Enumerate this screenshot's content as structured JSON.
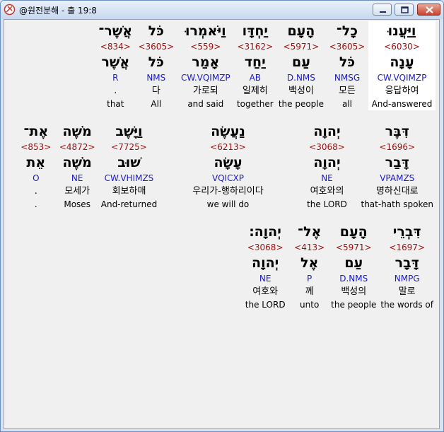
{
  "window": {
    "title": "@원전분해 - 출 19:8"
  },
  "rows": [
    [
      {
        "heb": "וַיַּעֲנוּ",
        "strong": "<6030>",
        "lex": "עָנָה",
        "morph": "CW.VQIMZP",
        "kor": "응답하여",
        "eng": "And-answered",
        "sel": true
      },
      {
        "heb": "כָל־",
        "strong": "<3605>",
        "lex": "כֹּל",
        "morph": "NMSG",
        "kor": "모든",
        "eng": "all"
      },
      {
        "heb": "הָעָם",
        "strong": "<5971>",
        "lex": "עַם",
        "morph": "D.NMS",
        "kor": "백성이",
        "eng": "the people"
      },
      {
        "heb": "יַחְדָּו",
        "strong": "<3162>",
        "lex": "יַחַד",
        "morph": "AB",
        "kor": "일제히",
        "eng": "together"
      },
      {
        "heb": "וַיֹּאמְרוּ",
        "strong": "<559>",
        "lex": "אָמַר",
        "morph": "CW.VQIMZP",
        "kor": "가로되",
        "eng": "and said"
      },
      {
        "heb": "כֹּל",
        "strong": "<3605>",
        "lex": "כֹּל",
        "morph": "NMS",
        "kor": "다",
        "eng": "All"
      },
      {
        "heb": "אֲשֶׁר־",
        "strong": "<834>",
        "lex": "אֲשֶׁר",
        "morph": "R",
        "kor": ".",
        "eng": "that"
      }
    ],
    [
      {
        "heb": "דִּבֶּר",
        "strong": "<1696>",
        "lex": "דָּבַר",
        "morph": "VPAMZS",
        "kor": "명하신대로",
        "eng": "that-hath spoken"
      },
      {
        "heb": "יְהוָה",
        "strong": "<3068>",
        "lex": "יְהוָה",
        "morph": "NE",
        "kor": "여호와의",
        "eng": "the LORD"
      },
      {
        "heb": "נַעֲשֶׂה",
        "strong": "<6213>",
        "lex": "עָשָׂה",
        "morph": "VQICXP",
        "kor": "우리가-행하리이다",
        "eng": "we will do"
      },
      {
        "heb": "וַיָּשֶׁב",
        "strong": "<7725>",
        "lex": "שׁוּב",
        "morph": "CW.VHIMZS",
        "kor": "회보하매",
        "eng": "And-returned"
      },
      {
        "heb": "מֹשֶׁה",
        "strong": "<4872>",
        "lex": "מֹשֶׁה",
        "morph": "NE",
        "kor": "모세가",
        "eng": "Moses"
      },
      {
        "heb": "אֶת־",
        "strong": "<853>",
        "lex": "אֵת",
        "morph": "O",
        "kor": ".",
        "eng": "."
      }
    ],
    [
      {
        "heb": "דִּבְרֵי",
        "strong": "<1697>",
        "lex": "דָּבָר",
        "morph": "NMPG",
        "kor": "말로",
        "eng": "the words of"
      },
      {
        "heb": "הָעָם",
        "strong": "<5971>",
        "lex": "עַם",
        "morph": "D.NMS",
        "kor": "백성의",
        "eng": "the people"
      },
      {
        "heb": "אֶל־",
        "strong": "<413>",
        "lex": "אֶל",
        "morph": "P",
        "kor": "께",
        "eng": "unto"
      },
      {
        "heb": "יְהוָה׃",
        "strong": "<3068>",
        "lex": "יְהוָה",
        "morph": "NE",
        "kor": "여호와",
        "eng": "the LORD"
      }
    ]
  ]
}
